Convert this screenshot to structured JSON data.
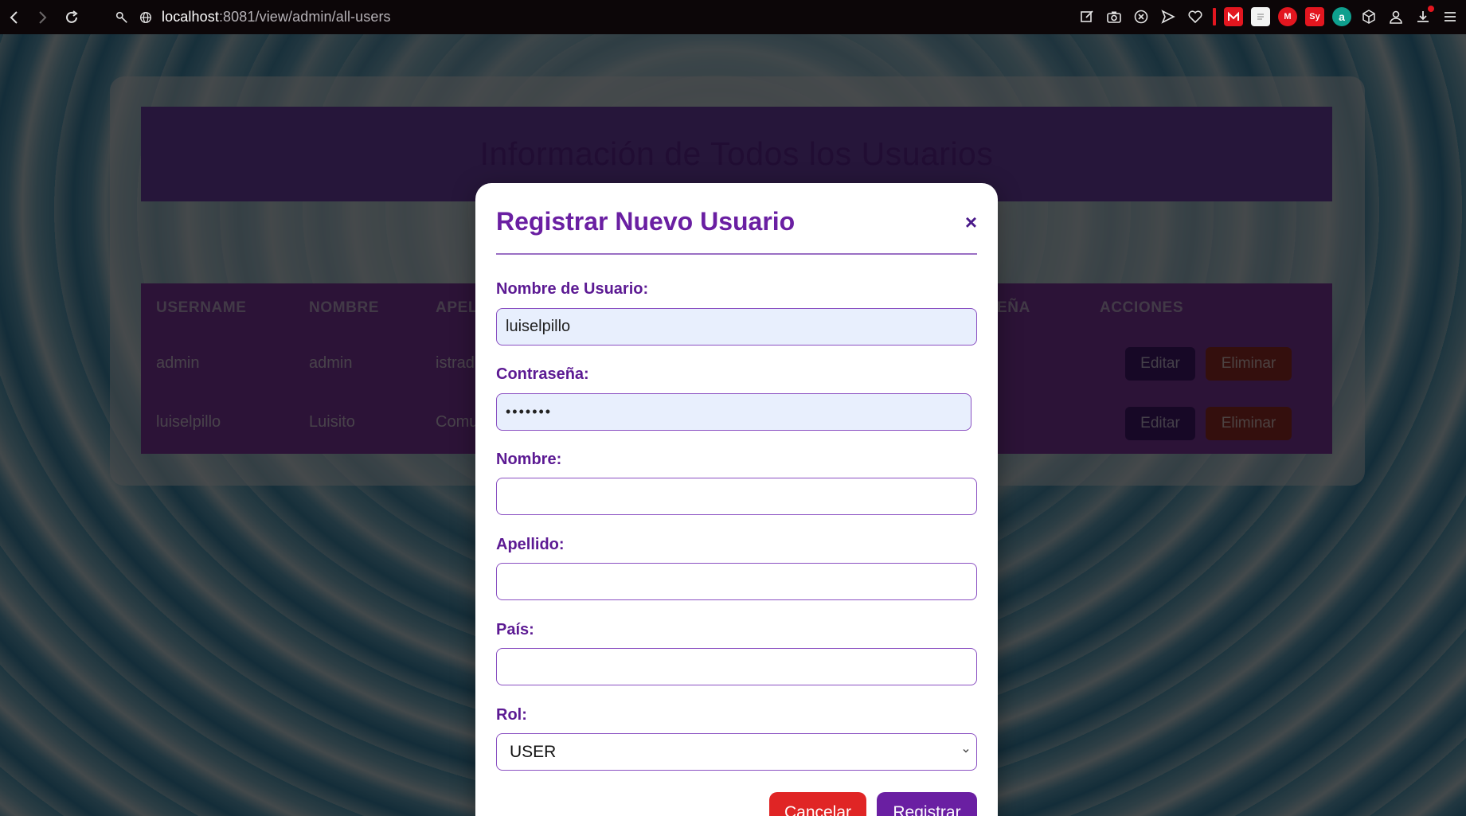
{
  "browser": {
    "url_host": "localhost",
    "url_path": ":8081/view/admin/all-users",
    "extensions": {
      "sy_label": "Sy",
      "m_label": "M",
      "a_label": "a"
    }
  },
  "page": {
    "title": "Información de Todos los Usuarios",
    "table": {
      "headers": [
        "USERNAME",
        "NOMBRE",
        "APEL",
        "EÑA",
        "ACCIONES"
      ],
      "rows": [
        {
          "username": "admin",
          "nombre": "admin",
          "apellido": "istrad",
          "edit": "Editar",
          "delete": "Eliminar"
        },
        {
          "username": "luiselpillo",
          "nombre": "Luisito",
          "apellido": "Comu",
          "edit": "Editar",
          "delete": "Eliminar"
        }
      ]
    }
  },
  "modal": {
    "title": "Registrar Nuevo Usuario",
    "close": "×",
    "fields": {
      "username_label": "Nombre de Usuario:",
      "username_value": "luiselpillo",
      "password_label": "Contraseña:",
      "password_value": "•••••••",
      "nombre_label": "Nombre:",
      "nombre_value": "",
      "apellido_label": "Apellido:",
      "apellido_value": "",
      "pais_label": "País:",
      "pais_value": "",
      "rol_label": "Rol:",
      "rol_value": "USER"
    },
    "buttons": {
      "cancel": "Cancelar",
      "submit": "Registrar"
    }
  }
}
